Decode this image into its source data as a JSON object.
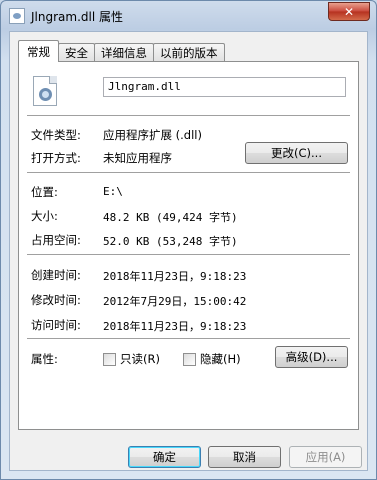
{
  "window": {
    "title": "Jlngram.dll 属性",
    "close_symbol": "✕"
  },
  "tabs": [
    {
      "label": "常规"
    },
    {
      "label": "安全"
    },
    {
      "label": "详细信息"
    },
    {
      "label": "以前的版本"
    }
  ],
  "general": {
    "file_name": "Jlngram.dll",
    "file_type_label": "文件类型:",
    "file_type_value": "应用程序扩展 (.dll)",
    "opens_with_label": "打开方式:",
    "opens_with_value": "未知应用程序",
    "change_button": "更改(C)...",
    "location_label": "位置:",
    "location_value": "E:\\",
    "size_label": "大小:",
    "size_value": "48.2 KB (49,424 字节)",
    "size_on_disk_label": "占用空间:",
    "size_on_disk_value": "52.0 KB (53,248 字节)",
    "created_label": "创建时间:",
    "created_value": "2018年11月23日，9:18:23",
    "modified_label": "修改时间:",
    "modified_value": "2012年7月29日，15:00:42",
    "accessed_label": "访问时间:",
    "accessed_value": "2018年11月23日，9:18:23",
    "attributes_label": "属性:",
    "readonly_label": "只读(R)",
    "hidden_label": "隐藏(H)",
    "advanced_button": "高级(D)..."
  },
  "footer": {
    "ok": "确定",
    "cancel": "取消",
    "apply": "应用(A)"
  },
  "icons": {
    "file": "dll-file-icon",
    "close": "close-icon"
  }
}
